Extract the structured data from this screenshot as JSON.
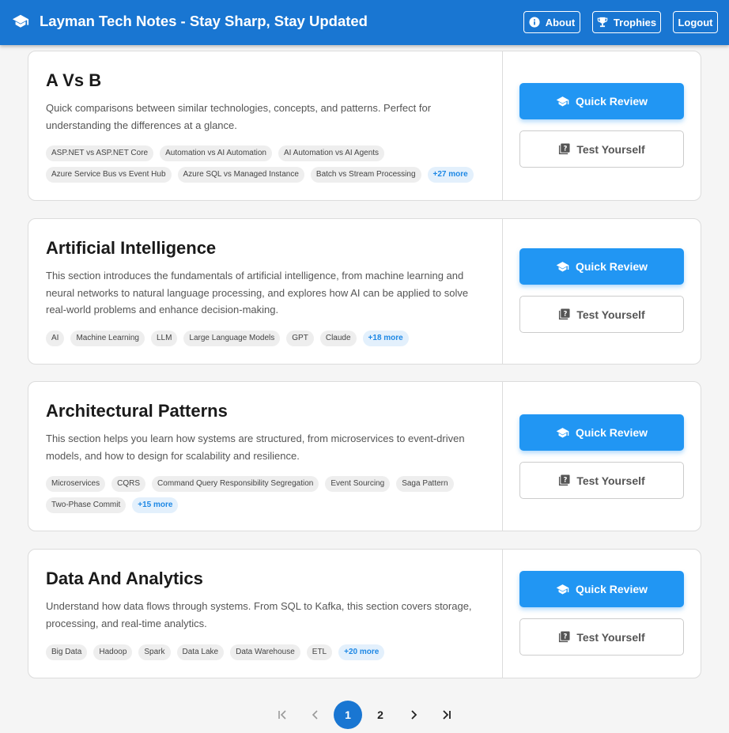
{
  "header": {
    "title": "Layman Tech Notes - Stay Sharp, Stay Updated",
    "brand_icon": "graduation-cap-icon",
    "about_label": "About",
    "trophies_label": "Trophies",
    "logout_label": "Logout"
  },
  "cards": [
    {
      "title": "A Vs B",
      "description": "Quick comparisons between similar technologies, concepts, and patterns. Perfect for understanding the differences at a glance.",
      "tags": [
        "ASP.NET vs ASP.NET Core",
        "Automation vs AI Automation",
        "AI Automation vs AI Agents",
        "Azure Service Bus vs Event Hub",
        "Azure SQL vs Managed Instance",
        "Batch vs Stream Processing"
      ],
      "more": "+27 more",
      "quick_review": "Quick Review",
      "test_yourself": "Test Yourself"
    },
    {
      "title": "Artificial Intelligence",
      "description": "This section introduces the fundamentals of artificial intelligence, from machine learning and neural networks to natural language processing, and explores how AI can be applied to solve real-world problems and enhance decision-making.",
      "tags": [
        "AI",
        "Machine Learning",
        "LLM",
        "Large Language Models",
        "GPT",
        "Claude"
      ],
      "more": "+18 more",
      "quick_review": "Quick Review",
      "test_yourself": "Test Yourself"
    },
    {
      "title": "Architectural Patterns",
      "description": "This section helps you learn how systems are structured, from microservices to event-driven models, and how to design for scalability and resilience.",
      "tags": [
        "Microservices",
        "CQRS",
        "Command Query Responsibility Segregation",
        "Event Sourcing",
        "Saga Pattern",
        "Two-Phase Commit"
      ],
      "more": "+15 more",
      "quick_review": "Quick Review",
      "test_yourself": "Test Yourself"
    },
    {
      "title": "Data And Analytics",
      "description": "Understand how data flows through systems. From SQL to Kafka, this section covers storage, processing, and real-time analytics.",
      "tags": [
        "Big Data",
        "Hadoop",
        "Spark",
        "Data Lake",
        "Data Warehouse",
        "ETL"
      ],
      "more": "+20 more",
      "quick_review": "Quick Review",
      "test_yourself": "Test Yourself"
    }
  ],
  "pagination": {
    "pages": [
      "1",
      "2"
    ],
    "current_page": "1"
  },
  "colors": {
    "appbar": "#1976d2",
    "primary_button": "#2196f3",
    "more_tag_text": "#1e88e5"
  }
}
